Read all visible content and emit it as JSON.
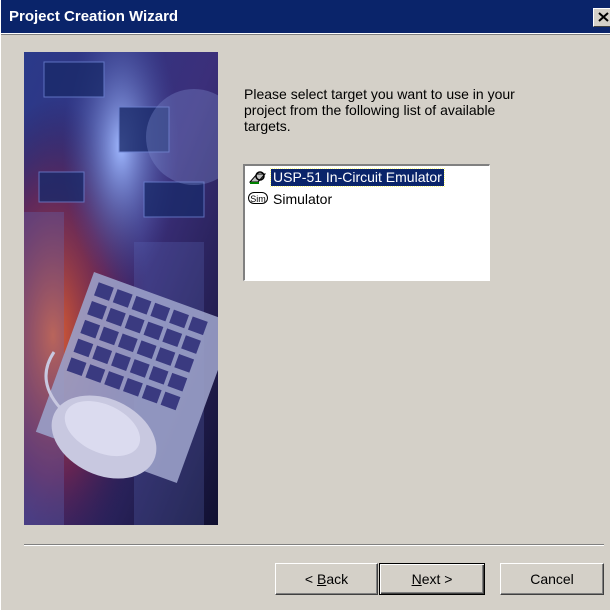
{
  "window": {
    "title": "Project Creation Wizard"
  },
  "instructions": "Please select target you want to use in your project from the following list of available targets.",
  "targets": [
    {
      "label": "USP-51 In-Circuit Emulator",
      "icon": "emulator-icon",
      "selected": true
    },
    {
      "label": "Simulator",
      "icon": "sim-icon",
      "icon_text": "Sim",
      "selected": false
    }
  ],
  "buttons": {
    "back_prefix": "< ",
    "back_mnemonic": "B",
    "back_rest": "ack",
    "next_mnemonic": "N",
    "next_rest": "ext >",
    "cancel": "Cancel"
  },
  "colors": {
    "titlebar": "#0a246a",
    "face": "#d4d0c8",
    "selection": "#0a246a"
  }
}
